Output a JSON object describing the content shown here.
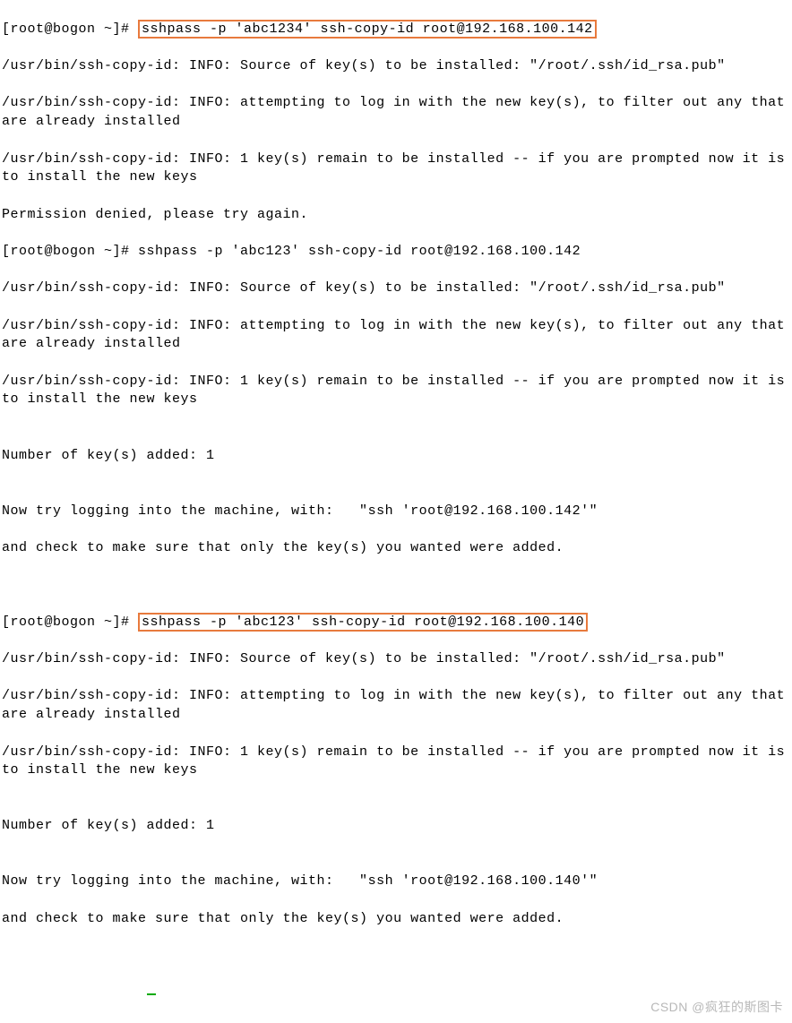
{
  "block1": {
    "prompt": "[root@bogon ~]# ",
    "command": "sshpass -p 'abc1234' ssh-copy-id root@192.168.100.142",
    "out1": "/usr/bin/ssh-copy-id: INFO: Source of key(s) to be installed: \"/root/.ssh/id_rsa.pub\"",
    "out2": "/usr/bin/ssh-copy-id: INFO: attempting to log in with the new key(s), to filter out any that are already installed",
    "out3": "/usr/bin/ssh-copy-id: INFO: 1 key(s) remain to be installed -- if you are prompted now it is to install the new keys",
    "out4": "Permission denied, please try again."
  },
  "block2": {
    "prompt": "[root@bogon ~]# ",
    "command": "sshpass -p 'abc123' ssh-copy-id root@192.168.100.142",
    "out1": "/usr/bin/ssh-copy-id: INFO: Source of key(s) to be installed: \"/root/.ssh/id_rsa.pub\"",
    "out2": "/usr/bin/ssh-copy-id: INFO: attempting to log in with the new key(s), to filter out any that are already installed",
    "out3": "/usr/bin/ssh-copy-id: INFO: 1 key(s) remain to be installed -- if you are prompted now it is to install the new keys",
    "blank1": "",
    "out4": "Number of key(s) added: 1",
    "blank2": "",
    "out5": "Now try logging into the machine, with:   \"ssh 'root@192.168.100.142'\"",
    "out6": "and check to make sure that only the key(s) you wanted were added."
  },
  "block3": {
    "prompt": "[root@bogon ~]# ",
    "command": "sshpass -p 'abc123' ssh-copy-id root@192.168.100.140",
    "out1": "/usr/bin/ssh-copy-id: INFO: Source of key(s) to be installed: \"/root/.ssh/id_rsa.pub\"",
    "out2": "/usr/bin/ssh-copy-id: INFO: attempting to log in with the new key(s), to filter out any that are already installed",
    "out3": "/usr/bin/ssh-copy-id: INFO: 1 key(s) remain to be installed -- if you are prompted now it is to install the new keys",
    "blank1": "",
    "out4": "Number of key(s) added: 1",
    "blank2": "",
    "out5": "Now try logging into the machine, with:   \"ssh 'root@192.168.100.140'\"",
    "out6": "and check to make sure that only the key(s) you wanted were added."
  },
  "watermark": "CSDN @疯狂的斯图卡"
}
